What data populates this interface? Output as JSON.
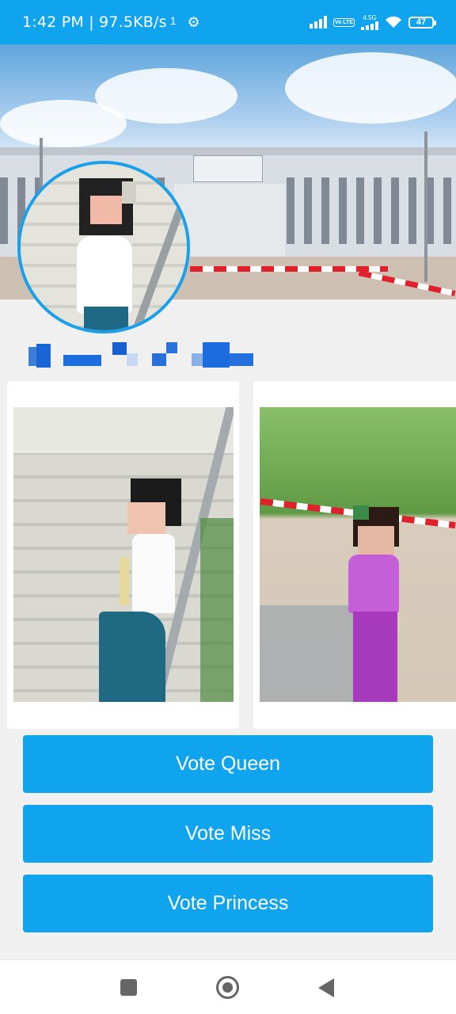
{
  "status_bar": {
    "time": "1:42 PM | 97.5KB/s",
    "extra": "1",
    "volte": "Vo LTE",
    "network": "4.5G",
    "battery": "47"
  },
  "profile": {
    "name": "(██ ████ █ ███"
  },
  "buttons": {
    "vote_queen": "Vote Queen",
    "vote_miss": "Vote Miss",
    "vote_princess": "Vote Princess"
  },
  "colors": {
    "accent": "#10a4ef",
    "background": "#f0f0f0"
  }
}
